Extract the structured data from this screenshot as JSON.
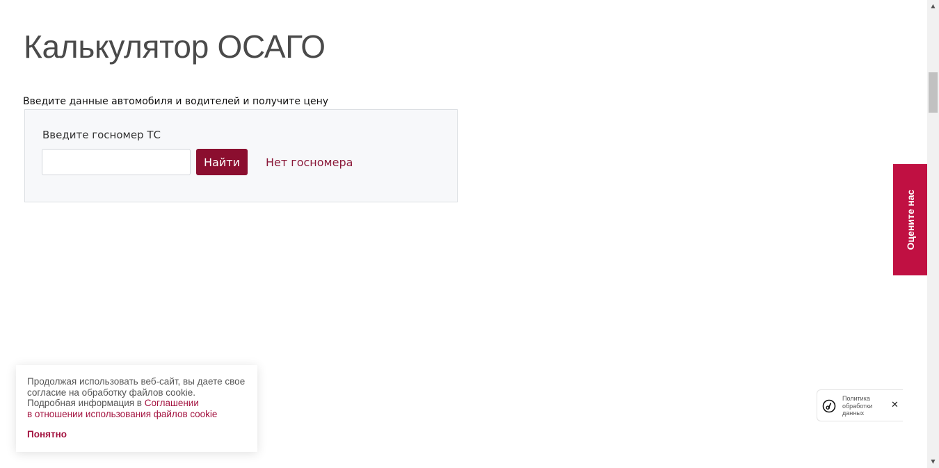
{
  "page": {
    "title": "Калькулятор ОСАГО",
    "subtitle": "Введите данные автомобиля и водителей и получите цену"
  },
  "calculator": {
    "plate_label": "Введите госномер ТС",
    "plate_value": "",
    "plate_placeholder": "",
    "find_button": "Найти",
    "no_plate_link": "Нет госномера"
  },
  "feedback_tab": {
    "label": "Оцените нас"
  },
  "cookie_banner": {
    "text": "Продолжая использовать веб-сайт, вы даете свое согласие на обработку файлов cookie. Подробная информация в ",
    "link_line1": "Соглашении",
    "link_line2": "в отношении использования файлов cookie",
    "ok_button": "Понятно"
  },
  "privacy_widget": {
    "line1": "Политика",
    "line2": "обработки",
    "line3": "данных",
    "icon": "privacy-logo-icon",
    "close_icon": "close-icon",
    "close_glyph": "✕"
  },
  "scrollbar": {
    "up_glyph": "▲",
    "down_glyph": "▼"
  },
  "colors": {
    "accent": "#8b0e2f",
    "feedback_tab": "#c01042",
    "link": "#a3123f",
    "title": "#4a4a4a",
    "panel_bg": "#f7f8fa"
  }
}
